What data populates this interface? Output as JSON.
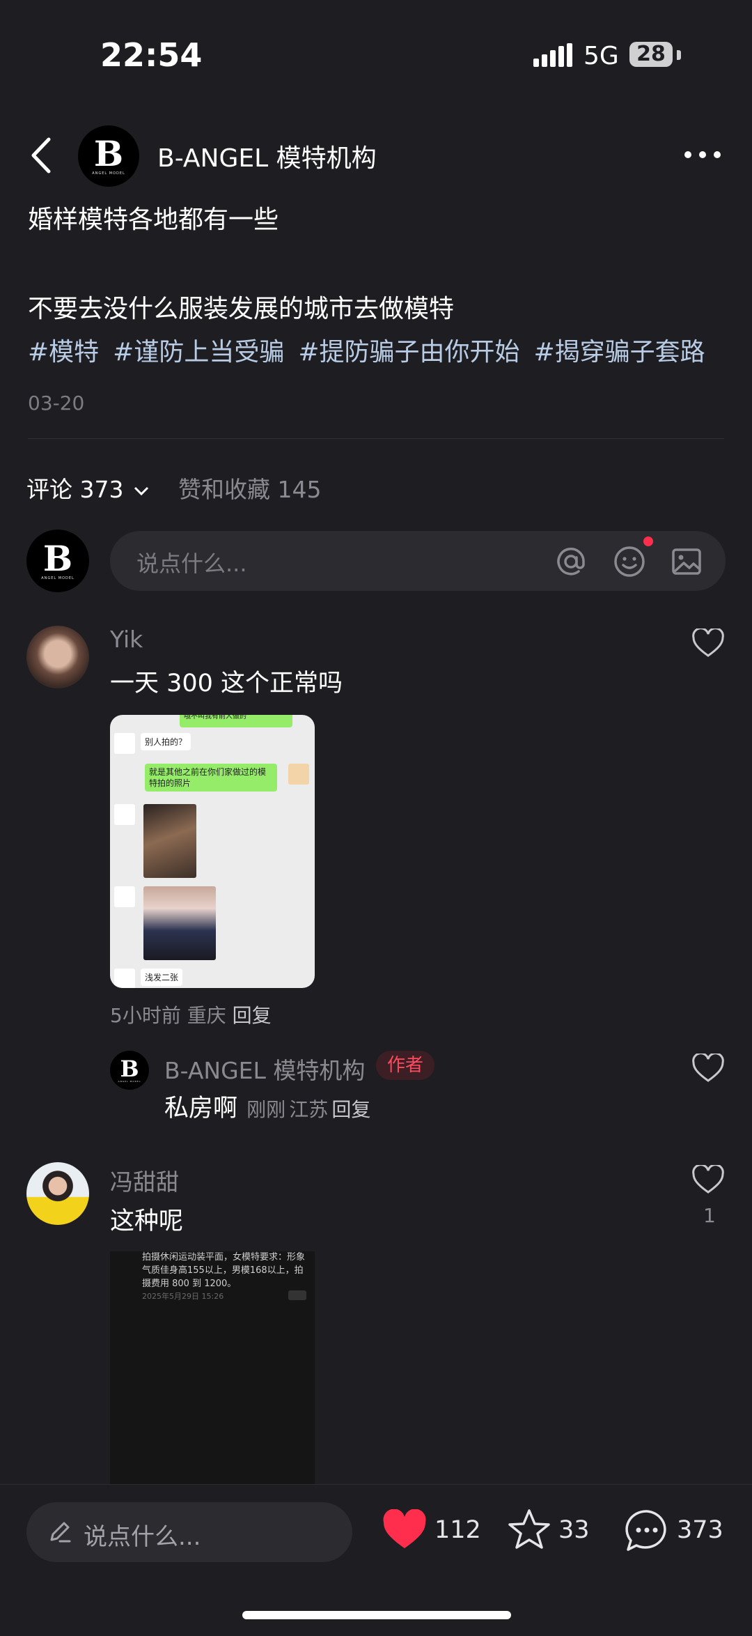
{
  "status": {
    "time": "22:54",
    "network": "5G",
    "battery": "28"
  },
  "header": {
    "account_name": "B-ANGEL 模特机构",
    "logo_letter": "B",
    "logo_text": "ANGEL MODEL"
  },
  "post": {
    "line1": "婚样模特各地都有一些",
    "line2": "不要去没什么服装发展的城市去做模特",
    "tags": [
      "#模特",
      "#谨防上当受骗",
      "#提防骗子由你开始",
      "#揭穿骗子套路"
    ],
    "date": "03-20"
  },
  "tabs": {
    "comments": "评论 373",
    "likes": "赞和收藏 145"
  },
  "comment_input": {
    "placeholder": "说点什么..."
  },
  "comments": [
    {
      "user": "Yik",
      "text": "一天 300 这个正常吗",
      "meta_time": "5小时前",
      "meta_location": "重庆",
      "meta_reply": "回复",
      "image": {
        "bubble_top": "哦不叫我有前人做的",
        "bubble_1": "别人拍的？",
        "bubble_2": "就是其他之前在你们家做过的模特拍的照片",
        "bubble_3": "浅发二张"
      }
    },
    {
      "user": "冯甜甜",
      "text": "这种呢",
      "like_count": "1",
      "image": {
        "message": "拍摄休闲运动装平面，女模特要求：形象气质佳身高155以上，男模168以上，拍摄费用 800 到 1200。",
        "timestamp": "2025年5月29日 15:26"
      }
    }
  ],
  "reply": {
    "user": "B-ANGEL 模特机构",
    "badge": "作者",
    "text": "私房啊",
    "meta_time": "刚刚",
    "meta_location": "江苏",
    "meta_reply": "回复"
  },
  "bottom_bar": {
    "placeholder": "说点什么...",
    "likes": "112",
    "stars": "33",
    "comments": "373"
  },
  "colors": {
    "background": "#1e1e22",
    "tag": "#b8cce6",
    "heart_red": "#ff2e4d",
    "author_badge": "#ff4a5e"
  }
}
